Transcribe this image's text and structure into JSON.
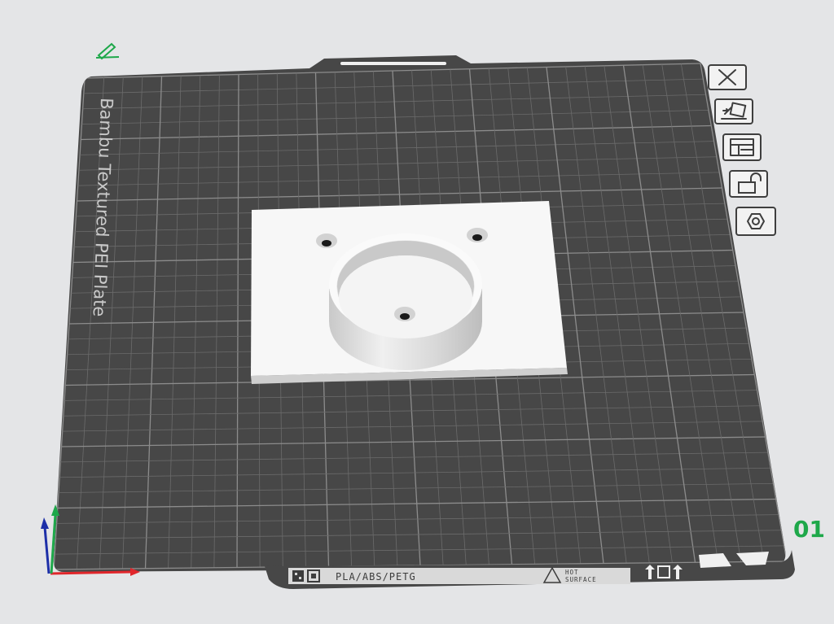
{
  "plate": {
    "name": "Bambu Textured PEI Plate",
    "number": "01",
    "strip_text": "PLA/ABS/PETG",
    "warning_line1": "HOT",
    "warning_line2": "SURFACE"
  },
  "toolbar": {
    "buttons": [
      {
        "name": "close-plate-button",
        "icon": "close-icon"
      },
      {
        "name": "auto-orient-button",
        "icon": "auto-orient-icon"
      },
      {
        "name": "arrange-button",
        "icon": "arrange-icon"
      },
      {
        "name": "lock-button",
        "icon": "unlock-icon"
      },
      {
        "name": "plate-settings-button",
        "icon": "hex-nut-icon"
      }
    ]
  },
  "icons": {
    "edit": "pencil-icon",
    "axes": "axes-gizmo-icon"
  },
  "colors": {
    "background": "#e4e5e7",
    "plate": "#474747",
    "grid": "#6f6f6f",
    "model": "#f7f7f7",
    "accent_green": "#1ea84a",
    "axis_x": "#e0262b",
    "axis_y": "#1ea84a",
    "axis_z": "#1d2fa8"
  }
}
